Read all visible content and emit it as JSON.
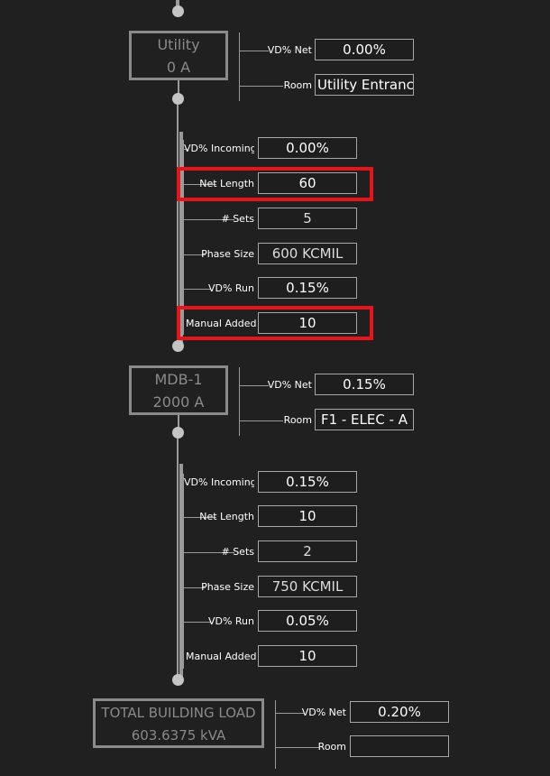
{
  "nodes": {
    "utility": {
      "name": "Utility",
      "rating": "0 A"
    },
    "mdb1": {
      "name": "MDB-1",
      "rating": "2000 A"
    },
    "total": {
      "name": "TOTAL BUILDING LOAD",
      "rating": "603.6375 kVA"
    }
  },
  "utility_panel": {
    "vd_net_label": "VD% Net",
    "vd_net_value": "0.00%",
    "room_label": "Room",
    "room_value": "Utility Entrance"
  },
  "feeder1": {
    "vd_incoming_label": "VD% Incoming",
    "vd_incoming_value": "0.00%",
    "net_length_label": "Net Length",
    "net_length_value": "60",
    "sets_label": "# Sets",
    "sets_value": "5",
    "phase_size_label": "Phase Size",
    "phase_size_value": "600 KCMIL",
    "vd_run_label": "VD% Run",
    "vd_run_value": "0.15%",
    "manual_added_label": "Manual Added L",
    "manual_added_value": "10"
  },
  "mdb1_panel": {
    "vd_net_label": "VD% Net",
    "vd_net_value": "0.15%",
    "room_label": "Room",
    "room_value": "F1 - ELEC - A"
  },
  "feeder2": {
    "vd_incoming_label": "VD% Incoming",
    "vd_incoming_value": "0.15%",
    "net_length_label": "Net Length",
    "net_length_value": "10",
    "sets_label": "# Sets",
    "sets_value": "2",
    "phase_size_label": "Phase Size",
    "phase_size_value": "750 KCMIL",
    "vd_run_label": "VD% Run",
    "vd_run_value": "0.05%",
    "manual_added_label": "Manual Added L",
    "manual_added_value": "10"
  },
  "total_panel": {
    "vd_net_label": "VD% Net",
    "vd_net_value": "0.20%",
    "room_label": "Room",
    "room_value": ""
  },
  "colors": {
    "background": "#202020",
    "highlight": "#e8141c",
    "node_border": "#8a8a8a"
  }
}
